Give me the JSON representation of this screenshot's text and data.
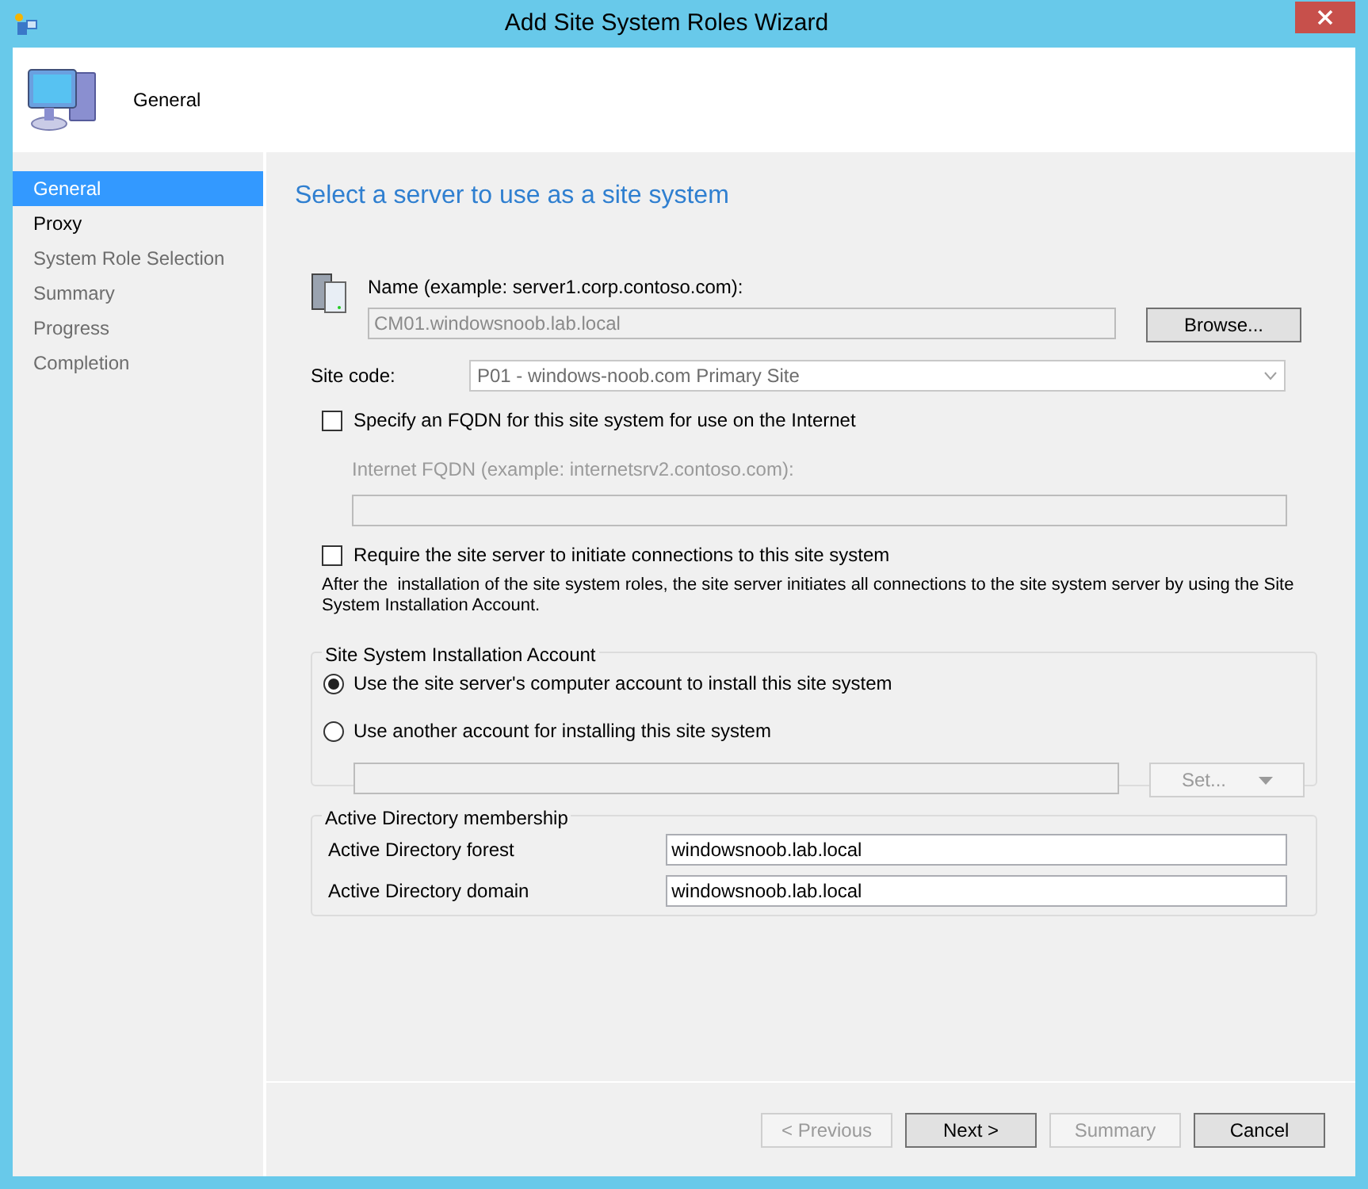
{
  "window": {
    "title": "Add Site System Roles Wizard"
  },
  "header": {
    "title": "General"
  },
  "nav": [
    {
      "label": "General",
      "selected": true,
      "disabled": false
    },
    {
      "label": "Proxy",
      "selected": false,
      "disabled": false
    },
    {
      "label": "System Role Selection",
      "selected": false,
      "disabled": true
    },
    {
      "label": "Summary",
      "selected": false,
      "disabled": true
    },
    {
      "label": "Progress",
      "selected": false,
      "disabled": true
    },
    {
      "label": "Completion",
      "selected": false,
      "disabled": true
    }
  ],
  "page_title": "Select a server to use as a site system",
  "name": {
    "label": "Name (example: server1.corp.contoso.com):",
    "value": "CM01.windowsnoob.lab.local",
    "disabled": true,
    "button": "Browse..."
  },
  "site_code": {
    "label": "Site code:",
    "value": "P01 - windows-noob.com Primary Site",
    "disabled": true
  },
  "fqdn_option": {
    "label": "Specify an FQDN for this site system for use on the Internet",
    "checked": false
  },
  "internet_fqdn": {
    "label": "Internet FQDN (example: internetsrv2.contoso.com):",
    "disabled": true
  },
  "initiate_option": {
    "label": "Require the site server to initiate connections to this site system",
    "checked": false
  },
  "note": "After the  installation of the site system roles, the site server initiates all connections to the site system server by using the Site System Installation Account.",
  "install_account": {
    "legend": "Site System Installation Account",
    "options": [
      {
        "label": "Use the site server's computer account to install this site system",
        "selected": true
      },
      {
        "label": "Use another account for installing this site system",
        "selected": false
      }
    ],
    "account_disabled": true,
    "set_button": "Set..."
  },
  "ad_membership": {
    "legend": "Active Directory membership",
    "rows": [
      {
        "label": "Active Directory forest",
        "value": "windowsnoob.lab.local"
      },
      {
        "label": "Active Directory domain",
        "value": "windowsnoob.lab.local"
      }
    ]
  },
  "buttons": [
    {
      "label": "< Previous",
      "disabled": true
    },
    {
      "label": "Next >",
      "disabled": false
    },
    {
      "label": "Summary",
      "disabled": true
    },
    {
      "label": "Cancel",
      "disabled": false
    }
  ]
}
